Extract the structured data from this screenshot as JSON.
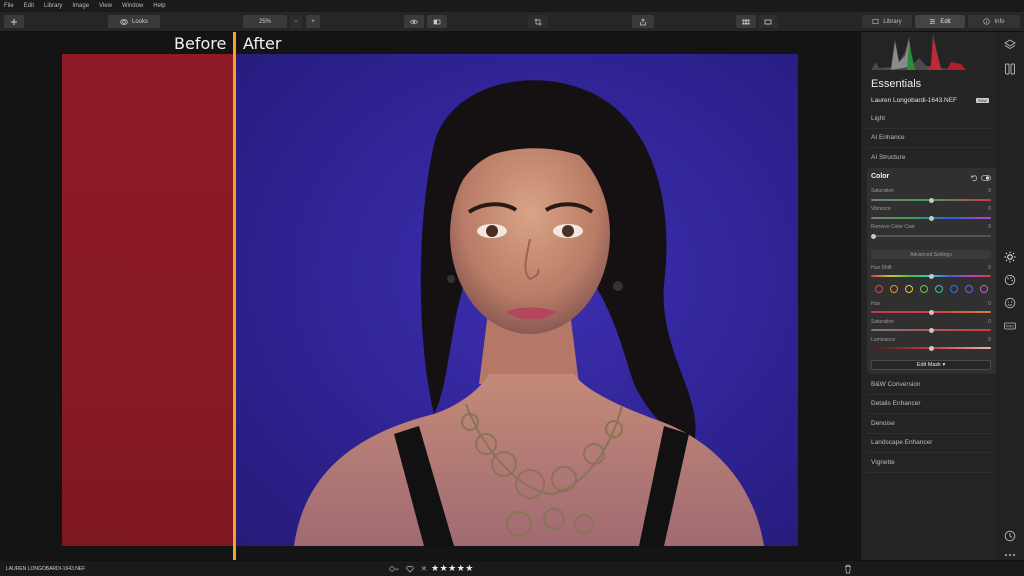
{
  "menu": [
    "File",
    "Edit",
    "Library",
    "Image",
    "View",
    "Window",
    "Help"
  ],
  "toolbar": {
    "looks_label": "Looks",
    "zoom": "25%",
    "minus": "−",
    "plus": "+"
  },
  "tabs": {
    "library": "Library",
    "edit": "Edit",
    "info": "Info"
  },
  "canvas": {
    "before_label": "Before",
    "after_label": "After"
  },
  "panel": {
    "title": "Essentials",
    "filename": "Lauren Longobardi-1643.NEF",
    "badge": "RAW",
    "sections_top": [
      "Light",
      "AI Enhance",
      "AI Structure"
    ],
    "color": {
      "title": "Color",
      "saturation_label": "Saturation",
      "saturation_value": "0",
      "vibrance_label": "Vibrance",
      "vibrance_value": "0",
      "remove_cast_label": "Remove Color Cast",
      "remove_cast_value": "0",
      "advanced_label": "Advanced Settings",
      "hue_shift_label": "Hue Shift",
      "hue_shift_value": "0",
      "hue_label": "Hue",
      "hue_value": "0",
      "sat2_label": "Saturation",
      "sat2_value": "0",
      "luminance_label": "Luminance",
      "luminance_value": "0",
      "edit_mask_label": "Edit Mask ▾",
      "swatches": [
        "#e0483d",
        "#e8913a",
        "#e0c93b",
        "#73c04b",
        "#3fc0b0",
        "#3f6fe0",
        "#7b5ee0",
        "#c75ec8"
      ]
    },
    "sections_bottom": [
      "B&W Conversion",
      "Details Enhancer",
      "Denoise",
      "Landscape Enhancer",
      "Vignette"
    ]
  },
  "status": {
    "filename": "LAUREN LONGOBARDI-1643.NEF",
    "rating": "★★★★★",
    "reject": "✕"
  }
}
